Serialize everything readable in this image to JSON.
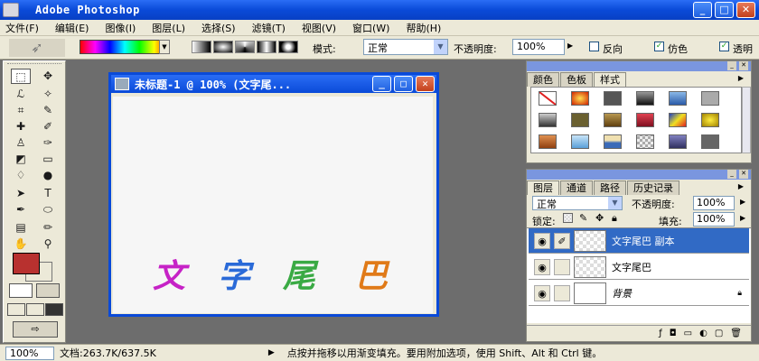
{
  "app": {
    "title": "Adobe Photoshop"
  },
  "menu": [
    "文件(F)",
    "编辑(E)",
    "图像(I)",
    "图层(L)",
    "选择(S)",
    "滤镜(T)",
    "视图(V)",
    "窗口(W)",
    "帮助(H)"
  ],
  "options": {
    "mode_label": "模式:",
    "mode_value": "正常",
    "opacity_label": "不透明度:",
    "opacity_value": "100%",
    "reverse_label": "反向",
    "dither_label": "仿色",
    "transparency_label": "透明"
  },
  "document": {
    "title": "未标题-1 @ 100% (文字尾...",
    "art_text": [
      "文",
      "字",
      "尾",
      "巴"
    ]
  },
  "colors": {
    "foreground": "#b8312f",
    "background": "#000000"
  },
  "styles_panel": {
    "tabs": [
      "颜色",
      "色板",
      "样式"
    ]
  },
  "layers_panel": {
    "tabs": [
      "图层",
      "通道",
      "路径",
      "历史记录"
    ],
    "blend_mode": "正常",
    "opacity_label": "不透明度:",
    "opacity_value": "100%",
    "lock_label": "锁定:",
    "fill_label": "填充:",
    "fill_value": "100%",
    "layers": [
      {
        "name": "文字尾巴 副本",
        "selected": true
      },
      {
        "name": "文字尾巴",
        "selected": false
      },
      {
        "name": "背景",
        "selected": false
      }
    ]
  },
  "status": {
    "zoom": "100%",
    "doc_size": "文档:263.7K/637.5K",
    "hint": "点按并拖移以用渐变填充。要用附加选项，使用 Shift、Alt 和 Ctrl 键。"
  }
}
